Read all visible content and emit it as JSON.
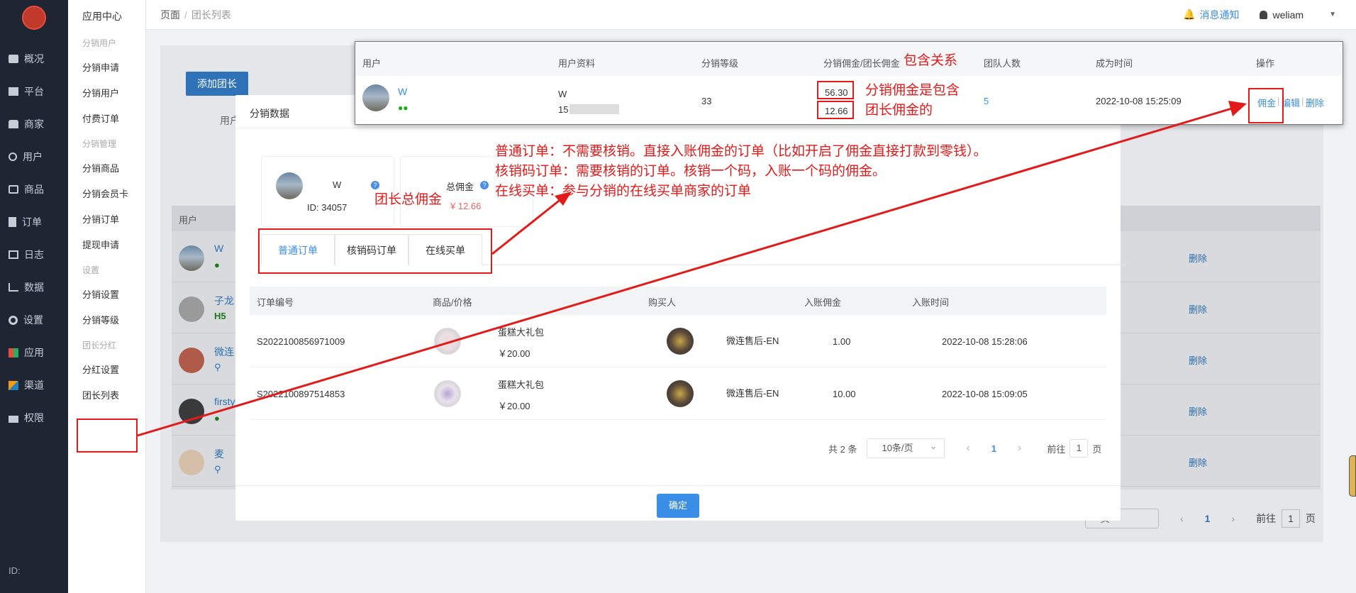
{
  "nav": {
    "items": [
      {
        "label": "概况"
      },
      {
        "label": "平台"
      },
      {
        "label": "商家"
      },
      {
        "label": "用户"
      },
      {
        "label": "商品"
      },
      {
        "label": "订单"
      },
      {
        "label": "日志"
      },
      {
        "label": "数据"
      },
      {
        "label": "设置"
      },
      {
        "label": "应用"
      },
      {
        "label": "渠道"
      },
      {
        "label": "权限"
      }
    ],
    "footer_id": "ID:"
  },
  "submenu": {
    "title": "应用中心",
    "groups": [
      {
        "title": "分销用户",
        "items": [
          "分销申请",
          "分销用户",
          "付费订单"
        ]
      },
      {
        "title": "分销管理",
        "items": [
          "分销商品",
          "分销会员卡",
          "分销订单",
          "提现申请"
        ]
      },
      {
        "title": "设置",
        "items": [
          "分销设置",
          "分销等级"
        ]
      },
      {
        "title": "团长分红",
        "items": [
          "分红设置",
          "团长列表"
        ]
      }
    ]
  },
  "topbar": {
    "crumb_root": "页面",
    "crumb_sep": "/",
    "crumb_current": "团长列表",
    "notice": "消息通知",
    "username": "weliam"
  },
  "background": {
    "add_button": "添加团长",
    "label_partial": "用户",
    "table_header": "用户",
    "rows": [
      {
        "name": "W",
        "tag": "wechat",
        "action": "删除"
      },
      {
        "name": "子龙",
        "tag": "H5",
        "action": "删除"
      },
      {
        "name": "微连",
        "tag": "link",
        "action": "删除"
      },
      {
        "name": "firsty",
        "tag": "wechat",
        "action": "删除"
      },
      {
        "name": "麦",
        "tag": "link",
        "action": "删除"
      }
    ],
    "pager_size": "页",
    "pager_page": "1",
    "pager_goto": "前往",
    "pager_goto_value": "1",
    "pager_goto_unit": "页"
  },
  "modal": {
    "title": "分销数据",
    "user_name": "W",
    "user_id": "ID: 34057",
    "total_label": "总佣金",
    "total_value": "¥ 12.66",
    "tabs": [
      "普通订单",
      "核销码订单",
      "在线买单"
    ],
    "columns": [
      "订单编号",
      "商品/价格",
      "购买人",
      "入账佣金",
      "入账时间"
    ],
    "rows": [
      {
        "order_no": "S2022100856971009",
        "product": "蛋糕大礼包",
        "price": "￥20.00",
        "buyer": "微连售后-EN",
        "commission": "1.00",
        "time": "2022-10-08 15:28:06"
      },
      {
        "order_no": "S2022100897514853",
        "product": "蛋糕大礼包",
        "price": "￥20.00",
        "buyer": "微连售后-EN",
        "commission": "10.00",
        "time": "2022-10-08 15:09:05"
      }
    ],
    "pager": {
      "total": "共 2 条",
      "size": "10条/页",
      "prev": "‹",
      "page": "1",
      "next": "›",
      "goto": "前往",
      "goto_value": "1",
      "goto_unit": "页"
    },
    "confirm": "确定"
  },
  "overlay": {
    "columns": [
      "用户",
      "用户资料",
      "分销等级",
      "分销佣金/团长佣金",
      "团队人数",
      "成为时间",
      "操作"
    ],
    "row": {
      "name": "W",
      "profile_name": "W",
      "profile_phone": "15",
      "level": "33",
      "dist_commission": "56.30",
      "leader_commission": "12.66",
      "team": "5",
      "time": "2022-10-08 15:25:09",
      "actions": [
        "佣金",
        "编辑",
        "删除"
      ]
    }
  },
  "annotations": {
    "contain": "包含关系",
    "contain_desc_1": "分销佣金是包含",
    "contain_desc_2": "团长佣金的",
    "total": "团长总佣金",
    "line1": "普通订单：不需要核销。直接入账佣金的订单（比如开启了佣金直接打款到零钱）。",
    "line2": "核销码订单：需要核销的订单。核销一个码，入账一个码的佣金。",
    "line3": "在线买单：参与分销的在线买单商家的订单",
    "color": "#e21a1a"
  }
}
